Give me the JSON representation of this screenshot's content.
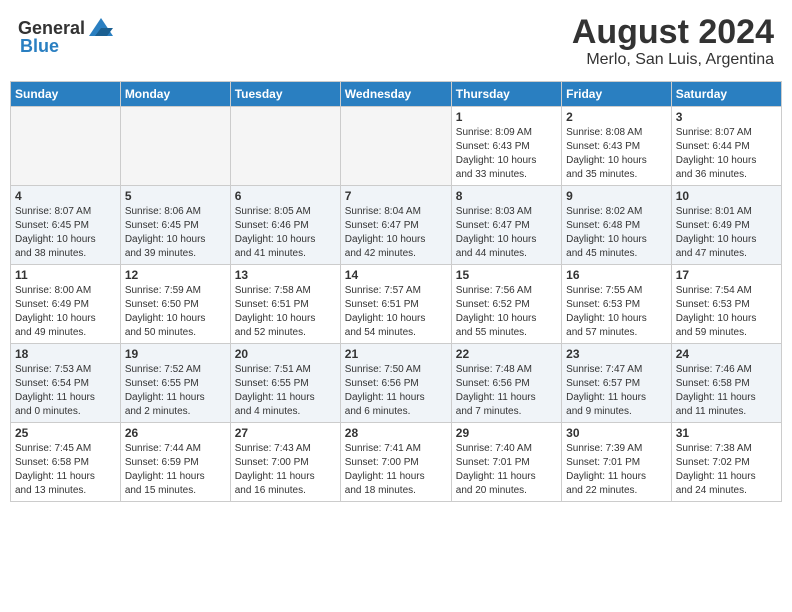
{
  "header": {
    "logo_general": "General",
    "logo_blue": "Blue",
    "month_year": "August 2024",
    "location": "Merlo, San Luis, Argentina"
  },
  "days_of_week": [
    "Sunday",
    "Monday",
    "Tuesday",
    "Wednesday",
    "Thursday",
    "Friday",
    "Saturday"
  ],
  "weeks": [
    [
      {
        "day": "",
        "info": ""
      },
      {
        "day": "",
        "info": ""
      },
      {
        "day": "",
        "info": ""
      },
      {
        "day": "",
        "info": ""
      },
      {
        "day": "1",
        "info": "Sunrise: 8:09 AM\nSunset: 6:43 PM\nDaylight: 10 hours\nand 33 minutes."
      },
      {
        "day": "2",
        "info": "Sunrise: 8:08 AM\nSunset: 6:43 PM\nDaylight: 10 hours\nand 35 minutes."
      },
      {
        "day": "3",
        "info": "Sunrise: 8:07 AM\nSunset: 6:44 PM\nDaylight: 10 hours\nand 36 minutes."
      }
    ],
    [
      {
        "day": "4",
        "info": "Sunrise: 8:07 AM\nSunset: 6:45 PM\nDaylight: 10 hours\nand 38 minutes."
      },
      {
        "day": "5",
        "info": "Sunrise: 8:06 AM\nSunset: 6:45 PM\nDaylight: 10 hours\nand 39 minutes."
      },
      {
        "day": "6",
        "info": "Sunrise: 8:05 AM\nSunset: 6:46 PM\nDaylight: 10 hours\nand 41 minutes."
      },
      {
        "day": "7",
        "info": "Sunrise: 8:04 AM\nSunset: 6:47 PM\nDaylight: 10 hours\nand 42 minutes."
      },
      {
        "day": "8",
        "info": "Sunrise: 8:03 AM\nSunset: 6:47 PM\nDaylight: 10 hours\nand 44 minutes."
      },
      {
        "day": "9",
        "info": "Sunrise: 8:02 AM\nSunset: 6:48 PM\nDaylight: 10 hours\nand 45 minutes."
      },
      {
        "day": "10",
        "info": "Sunrise: 8:01 AM\nSunset: 6:49 PM\nDaylight: 10 hours\nand 47 minutes."
      }
    ],
    [
      {
        "day": "11",
        "info": "Sunrise: 8:00 AM\nSunset: 6:49 PM\nDaylight: 10 hours\nand 49 minutes."
      },
      {
        "day": "12",
        "info": "Sunrise: 7:59 AM\nSunset: 6:50 PM\nDaylight: 10 hours\nand 50 minutes."
      },
      {
        "day": "13",
        "info": "Sunrise: 7:58 AM\nSunset: 6:51 PM\nDaylight: 10 hours\nand 52 minutes."
      },
      {
        "day": "14",
        "info": "Sunrise: 7:57 AM\nSunset: 6:51 PM\nDaylight: 10 hours\nand 54 minutes."
      },
      {
        "day": "15",
        "info": "Sunrise: 7:56 AM\nSunset: 6:52 PM\nDaylight: 10 hours\nand 55 minutes."
      },
      {
        "day": "16",
        "info": "Sunrise: 7:55 AM\nSunset: 6:53 PM\nDaylight: 10 hours\nand 57 minutes."
      },
      {
        "day": "17",
        "info": "Sunrise: 7:54 AM\nSunset: 6:53 PM\nDaylight: 10 hours\nand 59 minutes."
      }
    ],
    [
      {
        "day": "18",
        "info": "Sunrise: 7:53 AM\nSunset: 6:54 PM\nDaylight: 11 hours\nand 0 minutes."
      },
      {
        "day": "19",
        "info": "Sunrise: 7:52 AM\nSunset: 6:55 PM\nDaylight: 11 hours\nand 2 minutes."
      },
      {
        "day": "20",
        "info": "Sunrise: 7:51 AM\nSunset: 6:55 PM\nDaylight: 11 hours\nand 4 minutes."
      },
      {
        "day": "21",
        "info": "Sunrise: 7:50 AM\nSunset: 6:56 PM\nDaylight: 11 hours\nand 6 minutes."
      },
      {
        "day": "22",
        "info": "Sunrise: 7:48 AM\nSunset: 6:56 PM\nDaylight: 11 hours\nand 7 minutes."
      },
      {
        "day": "23",
        "info": "Sunrise: 7:47 AM\nSunset: 6:57 PM\nDaylight: 11 hours\nand 9 minutes."
      },
      {
        "day": "24",
        "info": "Sunrise: 7:46 AM\nSunset: 6:58 PM\nDaylight: 11 hours\nand 11 minutes."
      }
    ],
    [
      {
        "day": "25",
        "info": "Sunrise: 7:45 AM\nSunset: 6:58 PM\nDaylight: 11 hours\nand 13 minutes."
      },
      {
        "day": "26",
        "info": "Sunrise: 7:44 AM\nSunset: 6:59 PM\nDaylight: 11 hours\nand 15 minutes."
      },
      {
        "day": "27",
        "info": "Sunrise: 7:43 AM\nSunset: 7:00 PM\nDaylight: 11 hours\nand 16 minutes."
      },
      {
        "day": "28",
        "info": "Sunrise: 7:41 AM\nSunset: 7:00 PM\nDaylight: 11 hours\nand 18 minutes."
      },
      {
        "day": "29",
        "info": "Sunrise: 7:40 AM\nSunset: 7:01 PM\nDaylight: 11 hours\nand 20 minutes."
      },
      {
        "day": "30",
        "info": "Sunrise: 7:39 AM\nSunset: 7:01 PM\nDaylight: 11 hours\nand 22 minutes."
      },
      {
        "day": "31",
        "info": "Sunrise: 7:38 AM\nSunset: 7:02 PM\nDaylight: 11 hours\nand 24 minutes."
      }
    ]
  ]
}
